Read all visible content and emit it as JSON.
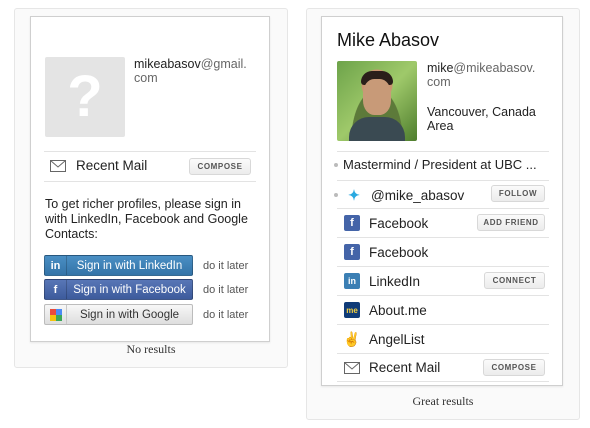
{
  "left": {
    "email_user": "mikeabasov",
    "email_domain": "@gmail.",
    "email_tld": "com",
    "recent_mail": "Recent Mail",
    "compose": "COMPOSE",
    "prompt": "To get richer profiles, please sign in with LinkedIn, Facebook and Google Contacts:",
    "buttons": [
      {
        "label": "Sign in with LinkedIn",
        "icon": "linkedin-icon",
        "later": "do it later"
      },
      {
        "label": "Sign in with Facebook",
        "icon": "facebook-icon",
        "later": "do it later"
      },
      {
        "label": "Sign in with Google",
        "icon": "google-icon",
        "later": "do it later"
      }
    ],
    "caption": "No results"
  },
  "right": {
    "name": "Mike Abasov",
    "email_user": "mike",
    "email_domain": "@mikeabasov.",
    "email_tld": "com",
    "location_line1": "Vancouver, Canada",
    "location_line2": "Area",
    "title": "Mastermind / President at UBC ...",
    "twitter": "@mike_abasov",
    "follow": "FOLLOW",
    "facebook1": "Facebook",
    "add_friend": "ADD FRIEND",
    "facebook2": "Facebook",
    "linkedin": "LinkedIn",
    "connect": "CONNECT",
    "aboutme": "About.me",
    "aboutme_badge": "me",
    "angellist": "AngelList",
    "recent_mail": "Recent Mail",
    "compose": "COMPOSE",
    "caption": "Great results"
  },
  "colors": {
    "linkedin": "#3b7fb4",
    "facebook": "#4464a8",
    "twitter": "#2aa9e0",
    "aboutme": "#0f3b78"
  }
}
